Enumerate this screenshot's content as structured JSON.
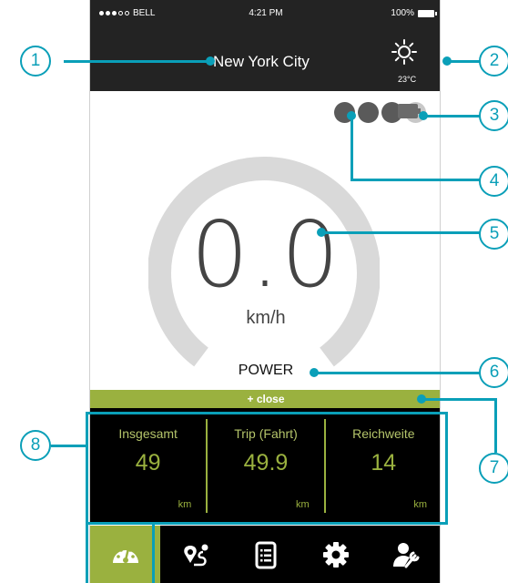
{
  "statusbar": {
    "carrier": "BELL",
    "time": "4:21 PM",
    "battery": "100%"
  },
  "header": {
    "city": "New York City",
    "weather_icon": "sun-icon",
    "temperature": "23°C"
  },
  "speed": {
    "value": "0.0",
    "unit": "km/h"
  },
  "mode": "POWER",
  "panel": {
    "close_label": "+ close"
  },
  "stats": [
    {
      "label": "Insgesamt",
      "value": "49",
      "unit": "km"
    },
    {
      "label": "Trip (Fahrt)",
      "value": "49.9",
      "unit": "km"
    },
    {
      "label": "Reichweite",
      "value": "14",
      "unit": "km"
    }
  ],
  "nav": [
    {
      "icon": "speedometer-icon",
      "active": true
    },
    {
      "icon": "route-icon",
      "active": false
    },
    {
      "icon": "document-list-icon",
      "active": false
    },
    {
      "icon": "gear-icon",
      "active": false
    },
    {
      "icon": "user-wrench-icon",
      "active": false
    }
  ],
  "callouts": [
    "1",
    "2",
    "3",
    "4",
    "5",
    "6",
    "7",
    "8"
  ],
  "colors": {
    "accent": "#9ab13f",
    "callout": "#0a9fb8",
    "header": "#232323"
  }
}
